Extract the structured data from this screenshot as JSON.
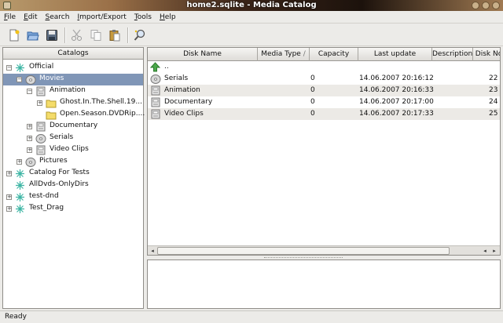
{
  "window": {
    "title": "home2.sqlite - Media Catalog"
  },
  "menu": [
    {
      "label": "File",
      "u": "F",
      "rest": "ile"
    },
    {
      "label": "Edit",
      "u": "E",
      "rest": "dit"
    },
    {
      "label": "Search",
      "u": "S",
      "rest": "earch"
    },
    {
      "label": "Import/Export",
      "u": "I",
      "rest": "mport/Export"
    },
    {
      "label": "Tools",
      "u": "T",
      "rest": "ools"
    },
    {
      "label": "Help",
      "u": "H",
      "rest": "elp"
    }
  ],
  "toolbar": {
    "icons": [
      "new-document-icon",
      "open-folder-icon",
      "save-disk-icon",
      "cut-scissors-icon",
      "copy-icon",
      "paste-icon",
      "search-magnifier-icon"
    ]
  },
  "catalogs": {
    "header": "Catalogs",
    "tree": [
      {
        "label": "Official",
        "icon": "catalog-icon",
        "level": 0,
        "expander": "-"
      },
      {
        "label": "Movies",
        "icon": "dvd-icon",
        "level": 1,
        "expander": "-",
        "selected": true
      },
      {
        "label": "Animation",
        "icon": "folder-disk-icon",
        "level": 2,
        "expander": "-"
      },
      {
        "label": "Ghost.In.The.Shell.19...",
        "icon": "folder-icon",
        "level": 3,
        "expander": "+"
      },
      {
        "label": "Open.Season.DVDRip....",
        "icon": "folder-icon",
        "level": 3,
        "expander": ""
      },
      {
        "label": "Documentary",
        "icon": "folder-disk-icon",
        "level": 2,
        "expander": "+"
      },
      {
        "label": "Serials",
        "icon": "cd-icon",
        "level": 2,
        "expander": "+"
      },
      {
        "label": "Video Clips",
        "icon": "folder-disk-icon",
        "level": 2,
        "expander": "+"
      },
      {
        "label": "Pictures",
        "icon": "cd-icon",
        "level": 1,
        "expander": "+"
      },
      {
        "label": "Catalog For Tests",
        "icon": "catalog-icon",
        "level": 0,
        "expander": "+"
      },
      {
        "label": "AllDvds-OnlyDirs",
        "icon": "catalog-icon",
        "level": 0,
        "expander": ""
      },
      {
        "label": "test-dnd",
        "icon": "catalog-icon",
        "level": 0,
        "expander": "+"
      },
      {
        "label": "Test_Drag",
        "icon": "catalog-icon",
        "level": 0,
        "expander": "+"
      }
    ]
  },
  "table": {
    "columns": [
      "Disk Name",
      "Media Type",
      "Capacity",
      "Last update",
      "Description",
      "Disk No"
    ],
    "sort_indicator": "/",
    "parent_label": "..",
    "rows": [
      {
        "name": "Serials",
        "icon": "cd-icon",
        "capacity": "0",
        "updated": "14.06.2007 20:16:12",
        "disk_no": "22"
      },
      {
        "name": "Animation",
        "icon": "folder-disk-icon",
        "capacity": "0",
        "updated": "14.06.2007 20:16:33",
        "disk_no": "23"
      },
      {
        "name": "Documentary",
        "icon": "folder-disk-icon",
        "capacity": "0",
        "updated": "14.06.2007 20:17:00",
        "disk_no": "24"
      },
      {
        "name": "Video Clips",
        "icon": "folder-disk-icon",
        "capacity": "0",
        "updated": "14.06.2007 20:17:33",
        "disk_no": "25"
      }
    ]
  },
  "status": {
    "text": "Ready"
  },
  "colors": {
    "selection": "#8096b7",
    "catalog_icon": "#3fb6a5",
    "folder": "#f4dc6a"
  }
}
